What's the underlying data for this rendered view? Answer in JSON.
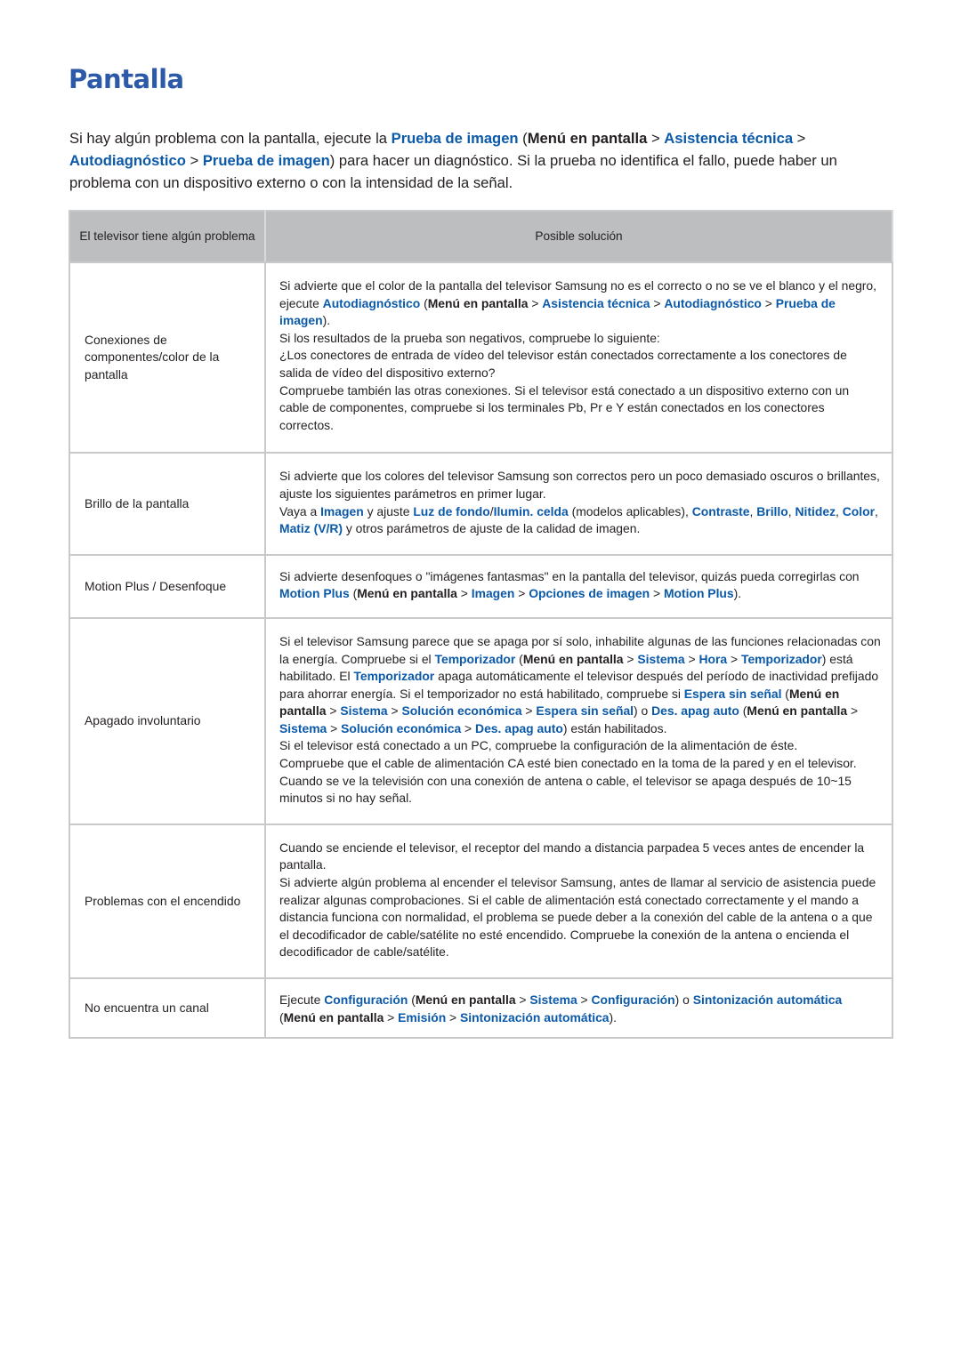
{
  "page": {
    "title": "Pantalla",
    "intro": [
      {
        "t": "Si hay algún problema con la pantalla, ejecute la ",
        "k": "text"
      },
      {
        "t": "Prueba de imagen",
        "k": "link"
      },
      {
        "t": " (",
        "k": "text"
      },
      {
        "t": "Menú en pantalla",
        "k": "menu"
      },
      {
        "t": " > ",
        "k": "text"
      },
      {
        "t": "Asistencia técnica",
        "k": "link"
      },
      {
        "t": " > ",
        "k": "text"
      },
      {
        "t": "Autodiagnóstico",
        "k": "link"
      },
      {
        "t": " > ",
        "k": "text"
      },
      {
        "t": "Prueba de imagen",
        "k": "link"
      },
      {
        "t": ") para hacer un diagnóstico. Si la prueba no identifica el fallo, puede haber un problema con un dispositivo externo o con la intensidad de la señal.",
        "k": "text"
      }
    ]
  },
  "table": {
    "headers": [
      "El televisor tiene algún problema",
      "Posible solución"
    ],
    "rows": [
      {
        "problem": "Conexiones de componentes/color de la pantalla",
        "height": "normal",
        "paragraphs": [
          [
            {
              "t": "Si advierte que el color de la pantalla del televisor Samsung no es el correcto o no se ve el blanco y el negro, ejecute ",
              "k": "text"
            },
            {
              "t": "Autodiagnóstico",
              "k": "link"
            },
            {
              "t": " (",
              "k": "text"
            },
            {
              "t": "Menú en pantalla",
              "k": "menu"
            },
            {
              "t": " > ",
              "k": "text"
            },
            {
              "t": "Asistencia técnica",
              "k": "link"
            },
            {
              "t": " > ",
              "k": "text"
            },
            {
              "t": "Autodiagnóstico",
              "k": "link"
            },
            {
              "t": " > ",
              "k": "text"
            },
            {
              "t": "Prueba de imagen",
              "k": "link"
            },
            {
              "t": ").",
              "k": "text"
            }
          ],
          [
            {
              "t": "Si los resultados de la prueba son negativos, compruebe lo siguiente:",
              "k": "text"
            }
          ],
          [
            {
              "t": "¿Los conectores de entrada de vídeo del televisor están conectados correctamente a los conectores de salida de vídeo del dispositivo externo?",
              "k": "text"
            }
          ],
          [
            {
              "t": "Compruebe también las otras conexiones. Si el televisor está conectado a un dispositivo externo con un cable de componentes, compruebe si los terminales Pb, Pr e Y están conectados en los conectores correctos.",
              "k": "text"
            }
          ]
        ]
      },
      {
        "problem": "Brillo de la pantalla",
        "paragraphs": [
          [
            {
              "t": "Si advierte que los colores del televisor Samsung son correctos pero un poco demasiado oscuros o brillantes, ajuste los siguientes parámetros en primer lugar.",
              "k": "text"
            }
          ],
          [
            {
              "t": "Vaya a ",
              "k": "text"
            },
            {
              "t": "Imagen",
              "k": "link"
            },
            {
              "t": " y ajuste ",
              "k": "text"
            },
            {
              "t": "Luz de fondo",
              "k": "link"
            },
            {
              "t": "/",
              "k": "text"
            },
            {
              "t": "Ilumin. celda",
              "k": "link"
            },
            {
              "t": " (modelos aplicables), ",
              "k": "text"
            },
            {
              "t": "Contraste",
              "k": "link"
            },
            {
              "t": ", ",
              "k": "text"
            },
            {
              "t": "Brillo",
              "k": "link"
            },
            {
              "t": ", ",
              "k": "text"
            },
            {
              "t": "Nitidez",
              "k": "link"
            },
            {
              "t": ", ",
              "k": "text"
            },
            {
              "t": "Color",
              "k": "link"
            },
            {
              "t": ", ",
              "k": "text"
            },
            {
              "t": "Matiz (V/R)",
              "k": "link"
            },
            {
              "t": " y otros parámetros de ajuste de la calidad de imagen.",
              "k": "text"
            }
          ]
        ]
      },
      {
        "problem": "Motion Plus / Desenfoque",
        "paragraphs": [
          [
            {
              "t": "Si advierte desenfoques o \"imágenes fantasmas\" en la pantalla del televisor, quizás pueda corregirlas con ",
              "k": "text"
            },
            {
              "t": "Motion Plus",
              "k": "link"
            },
            {
              "t": " (",
              "k": "text"
            },
            {
              "t": "Menú en pantalla",
              "k": "menu"
            },
            {
              "t": " > ",
              "k": "text"
            },
            {
              "t": "Imagen",
              "k": "link"
            },
            {
              "t": " > ",
              "k": "text"
            },
            {
              "t": "Opciones de imagen",
              "k": "link"
            },
            {
              "t": " > ",
              "k": "text"
            },
            {
              "t": "Motion Plus",
              "k": "link"
            },
            {
              "t": ").",
              "k": "text"
            }
          ]
        ]
      },
      {
        "problem": "Apagado involuntario",
        "paragraphs": [
          [
            {
              "t": "Si el televisor Samsung parece que se apaga por sí solo, inhabilite algunas de las funciones relacionadas con la energía. Compruebe si el ",
              "k": "text"
            },
            {
              "t": "Temporizador",
              "k": "link"
            },
            {
              "t": " (",
              "k": "text"
            },
            {
              "t": "Menú en pantalla",
              "k": "menu"
            },
            {
              "t": " > ",
              "k": "text"
            },
            {
              "t": "Sistema",
              "k": "link"
            },
            {
              "t": " > ",
              "k": "text"
            },
            {
              "t": "Hora",
              "k": "link"
            },
            {
              "t": " > ",
              "k": "text"
            },
            {
              "t": "Temporizador",
              "k": "link"
            },
            {
              "t": ") está habilitado. El ",
              "k": "text"
            },
            {
              "t": "Temporizador",
              "k": "link"
            },
            {
              "t": " apaga automáticamente el televisor después del período de inactividad prefijado para ahorrar energía. Si el temporizador no está habilitado, compruebe si ",
              "k": "text"
            },
            {
              "t": "Espera sin señal",
              "k": "link"
            },
            {
              "t": " (",
              "k": "text"
            },
            {
              "t": "Menú en pantalla",
              "k": "menu"
            },
            {
              "t": " > ",
              "k": "text"
            },
            {
              "t": "Sistema",
              "k": "link"
            },
            {
              "t": " > ",
              "k": "text"
            },
            {
              "t": "Solución económica",
              "k": "link"
            },
            {
              "t": " > ",
              "k": "text"
            },
            {
              "t": "Espera sin señal",
              "k": "link"
            },
            {
              "t": ") o ",
              "k": "text"
            },
            {
              "t": "Des. apag auto",
              "k": "link"
            },
            {
              "t": " (",
              "k": "text"
            },
            {
              "t": "Menú en pantalla",
              "k": "menu"
            },
            {
              "t": " > ",
              "k": "text"
            },
            {
              "t": "Sistema",
              "k": "link"
            },
            {
              "t": " > ",
              "k": "text"
            },
            {
              "t": "Solución económica",
              "k": "link"
            },
            {
              "t": " > ",
              "k": "text"
            },
            {
              "t": "Des. apag auto",
              "k": "link"
            },
            {
              "t": ") están habilitados.",
              "k": "text"
            }
          ],
          [
            {
              "t": "Si el televisor está conectado a un PC, compruebe la configuración de la alimentación de éste.",
              "k": "text"
            }
          ],
          [
            {
              "t": "Compruebe que el cable de alimentación CA esté bien conectado en la toma de la pared y en el televisor.",
              "k": "text"
            }
          ],
          [
            {
              "t": "Cuando se ve la televisión con una conexión de antena o cable, el televisor se apaga después de 10~15 minutos si no hay señal.",
              "k": "text"
            }
          ]
        ]
      },
      {
        "problem": "Problemas con el encendido",
        "paragraphs": [
          [
            {
              "t": "Cuando se enciende el televisor, el receptor del mando a distancia parpadea 5 veces antes de encender la pantalla.",
              "k": "text"
            }
          ],
          [
            {
              "t": "Si advierte algún problema al encender el televisor Samsung, antes de llamar al servicio de asistencia puede realizar algunas comprobaciones. Si el cable de alimentación está conectado correctamente y el mando a distancia funciona con normalidad, el problema se puede deber a la conexión del cable de la antena o a que el decodificador de cable/satélite no esté encendido. Compruebe la conexión de la antena o encienda el decodificador de cable/satélite.",
              "k": "text"
            }
          ]
        ]
      },
      {
        "problem": "No encuentra un canal",
        "paragraphs": [
          [
            {
              "t": "Ejecute ",
              "k": "text"
            },
            {
              "t": "Configuración",
              "k": "link"
            },
            {
              "t": " (",
              "k": "text"
            },
            {
              "t": "Menú en pantalla",
              "k": "menu"
            },
            {
              "t": " > ",
              "k": "text"
            },
            {
              "t": "Sistema",
              "k": "link"
            },
            {
              "t": " > ",
              "k": "text"
            },
            {
              "t": "Configuración",
              "k": "link"
            },
            {
              "t": ") o ",
              "k": "text"
            },
            {
              "t": "Sintonización automática",
              "k": "link"
            },
            {
              "t": " (",
              "k": "text"
            },
            {
              "t": "Menú en pantalla",
              "k": "menu"
            },
            {
              "t": " > ",
              "k": "text"
            },
            {
              "t": "Emisión",
              "k": "link"
            },
            {
              "t": " > ",
              "k": "text"
            },
            {
              "t": "Sintonización automática",
              "k": "link"
            },
            {
              "t": ").",
              "k": "text"
            }
          ]
        ]
      }
    ]
  },
  "colors": {
    "title": "#2c5aa8",
    "link": "#0b59a9",
    "header_bg": "#bcbec0",
    "border": "#c8c9ca",
    "text": "#231f20"
  }
}
